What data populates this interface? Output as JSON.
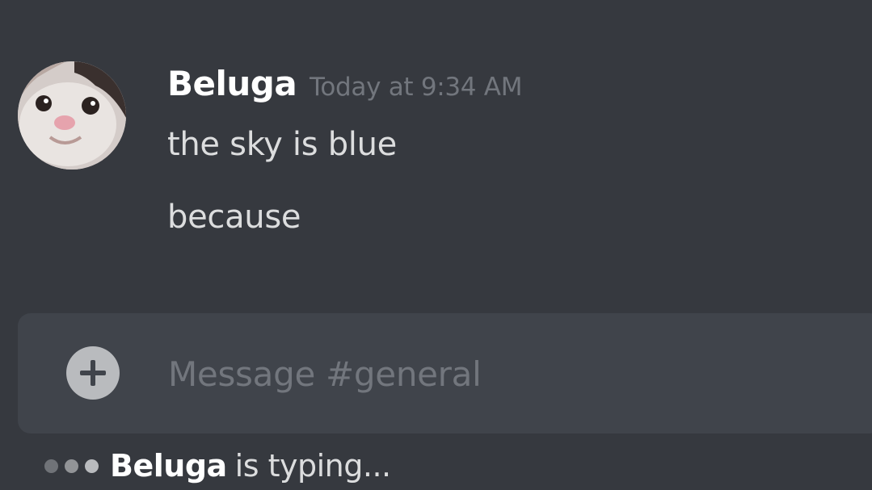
{
  "message": {
    "username": "Beluga",
    "timestamp": "Today at 9:34 AM",
    "avatar_icon": "beluga-cat-avatar",
    "lines": [
      "the sky is blue",
      "because"
    ]
  },
  "composer": {
    "placeholder": "Message #general",
    "value": "",
    "add_icon": "plus-circle-icon"
  },
  "typing_indicator": {
    "user": "Beluga",
    "text": "is typing..."
  },
  "colors": {
    "background": "#36393f",
    "composer_background": "#40444b",
    "username": "#ffffff",
    "timestamp": "#72767d",
    "message_text": "#dcddde",
    "placeholder": "#72767d",
    "icon": "#b9bbbe"
  }
}
